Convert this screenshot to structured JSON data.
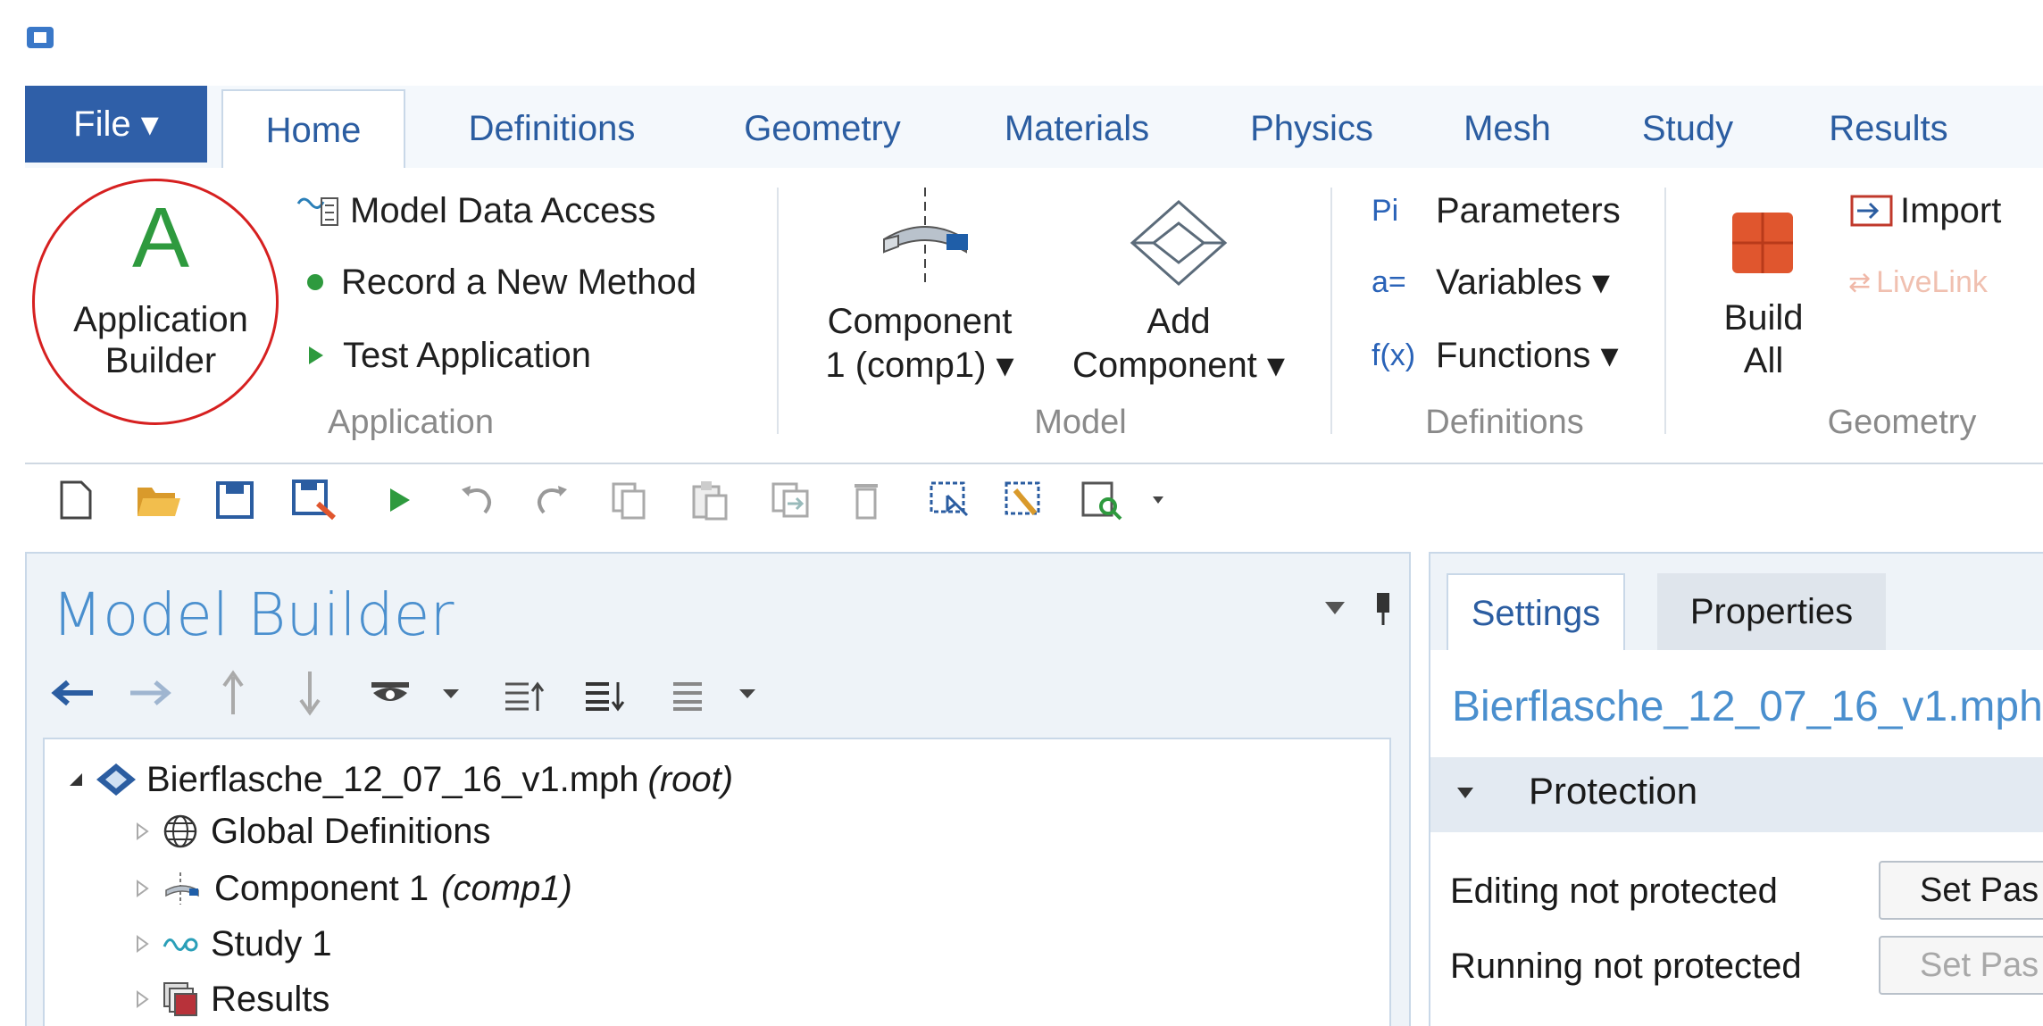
{
  "window": {
    "icon": "comsol-app-icon"
  },
  "menu": {
    "file_label": "File ▾"
  },
  "tabs": [
    "Home",
    "Definitions",
    "Geometry",
    "Materials",
    "Physics",
    "Mesh",
    "Study",
    "Results"
  ],
  "ribbon": {
    "application": {
      "builder_big": "A",
      "builder_line1": "Application",
      "builder_line2": "Builder",
      "model_data_access": "Model Data Access",
      "record_method": "Record a New Method",
      "test_application": "Test Application",
      "group_label": "Application"
    },
    "model": {
      "component_line1": "Component",
      "component_line2": "1 (comp1) ▾",
      "add_line1": "Add",
      "add_line2": "Component ▾",
      "group_label": "Model"
    },
    "definitions": {
      "parameters_prefix": "Pi",
      "parameters": "Parameters",
      "variables_prefix": "a=",
      "variables": "Variables ▾",
      "functions_prefix": "f(x)",
      "functions": "Functions ▾",
      "group_label": "Definitions"
    },
    "geometry": {
      "build_line1": "Build",
      "build_line2": "All",
      "import": "Import",
      "livelink": "LiveLink",
      "group_label": "Geometry"
    }
  },
  "model_builder": {
    "title": "Model Builder",
    "tree": [
      {
        "label": "Bierflasche_12_07_16_v1.mph",
        "suffix": "(root)"
      },
      {
        "label": "Global Definitions",
        "suffix": ""
      },
      {
        "label": "Component 1",
        "suffix": "(comp1)"
      },
      {
        "label": "Study 1",
        "suffix": ""
      },
      {
        "label": "Results",
        "suffix": ""
      }
    ]
  },
  "settings": {
    "tab_settings": "Settings",
    "tab_properties": "Properties",
    "file_name": "Bierflasche_12_07_16_v1.mph",
    "section": "Protection",
    "editing_label": "Editing not protected",
    "editing_button": "Set Pas",
    "running_label": "Running not protected",
    "running_button": "Set Pas"
  },
  "colors": {
    "accent": "#2f5fa8",
    "tab_text": "#2b5da1",
    "highlight_circle": "#d62020",
    "panel_bg": "#eef3f8"
  }
}
